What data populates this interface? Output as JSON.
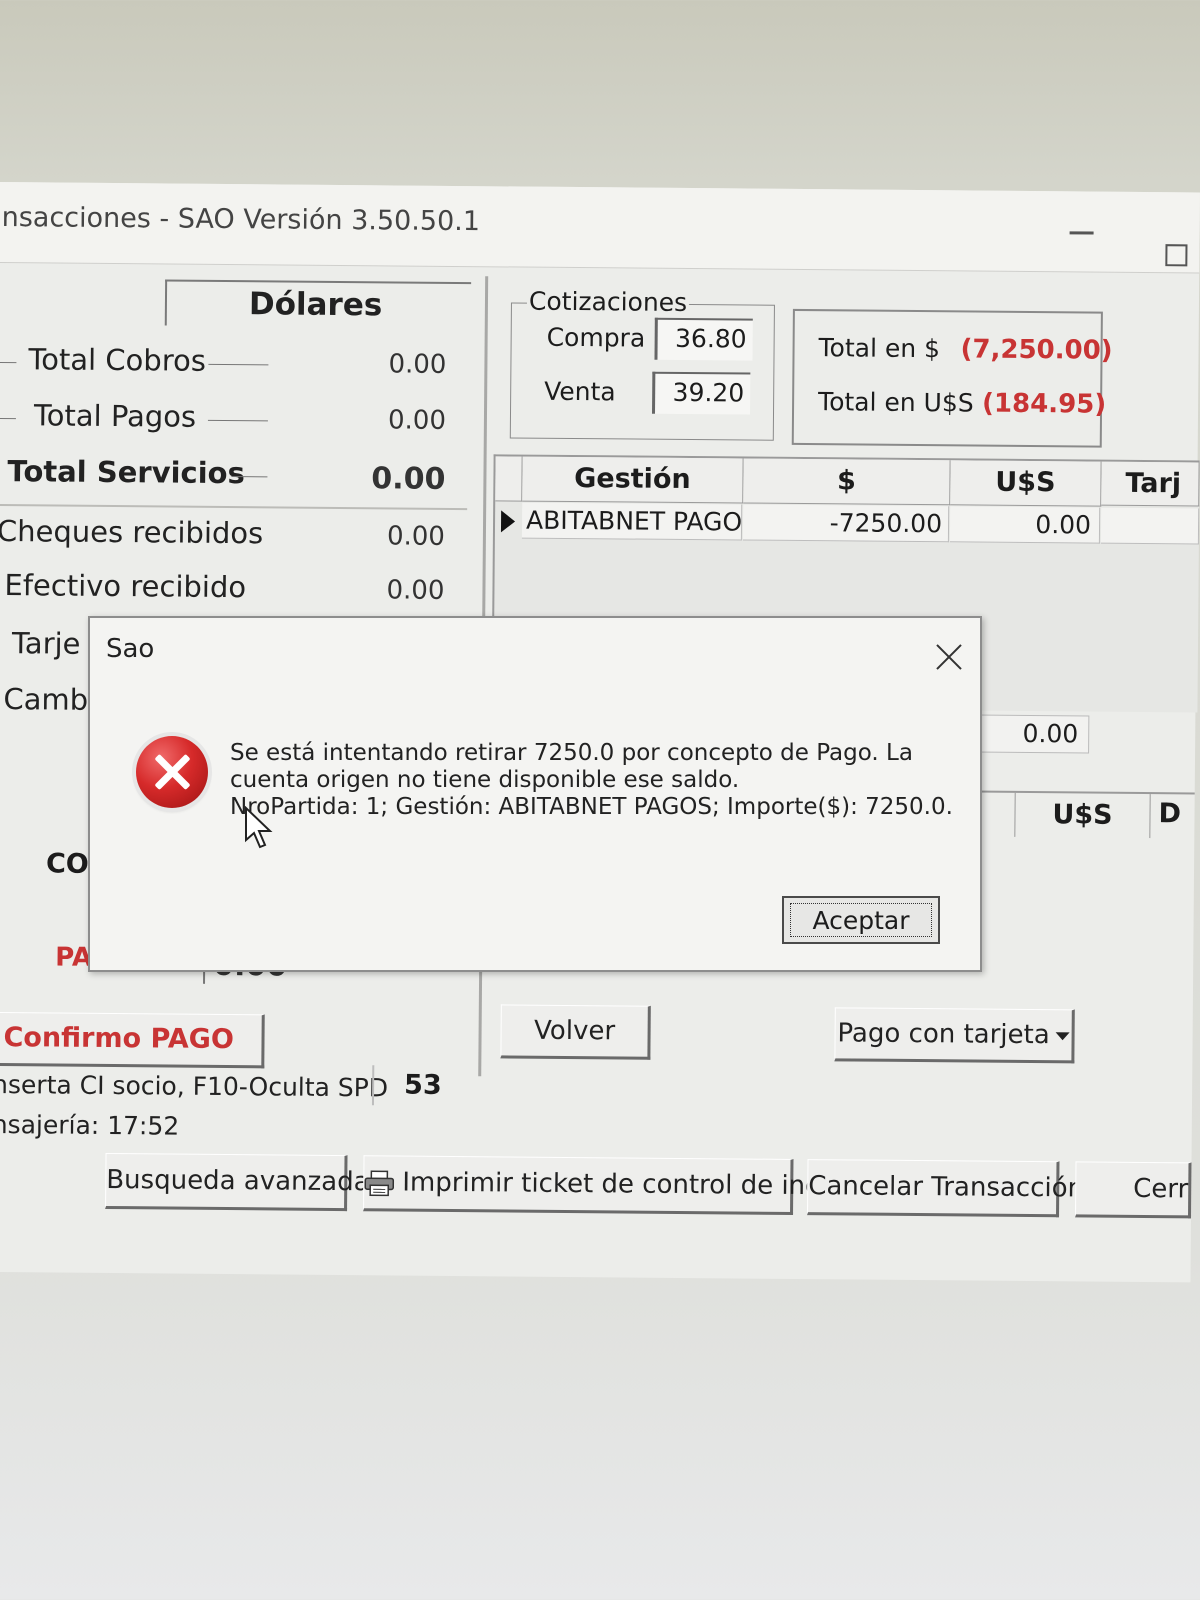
{
  "window": {
    "title": "nsacciones -  SAO Versión 3.50.50.1"
  },
  "summary": {
    "tab_label": "Dólares",
    "rows": [
      {
        "label": "Total Cobros",
        "value": "0.00"
      },
      {
        "label": "Total Pagos",
        "value": "0.00"
      },
      {
        "label": "Total Servicios",
        "value": "0.00"
      },
      {
        "label": "Cheques recibidos",
        "value": "0.00"
      },
      {
        "label": "Efectivo recibido",
        "value": "0.00"
      },
      {
        "label": "Tarje",
        "value": ""
      },
      {
        "label": "Camb",
        "value": ""
      }
    ],
    "co_label": "CO",
    "pa_label": "PA",
    "amount_peek": "0.00"
  },
  "cotizaciones": {
    "legend": "Cotizaciones",
    "compra_label": "Compra",
    "compra_value": "36.80",
    "venta_label": "Venta",
    "venta_value": "39.20"
  },
  "totals": {
    "pesos_label": "Total en $",
    "pesos_value": "(7,250.00)",
    "usd_label": "Total en U$S",
    "usd_value": "(184.95)"
  },
  "grid": {
    "headers": [
      "Gestión",
      "$",
      "U$S",
      "Tarj"
    ],
    "rows": [
      {
        "gestion": "ABITABNET PAGOS",
        "pesos": "-7250.00",
        "usd": "0.00"
      }
    ]
  },
  "right_panel": {
    "value": "0.00",
    "grid2_header": "U$S",
    "grid2_extra": "D"
  },
  "buttons": {
    "confirmo": "Confirmo PAGO",
    "volver": "Volver",
    "pago_tarjeta": "Pago con tarjeta",
    "busqueda": "Busqueda avanzada",
    "imprimir": "Imprimir ticket de control de ingreso",
    "cancelar": "Cancelar Transacción",
    "cerrar": "Cerr"
  },
  "status": {
    "line1": "nserta CI socio, F10-Oculta SPD",
    "count": "53",
    "line2": "nsajería: 17:52"
  },
  "dialog": {
    "title": "Sao",
    "message_lines": [
      "Se está intentando retirar 7250.0 por concepto de Pago. La",
      "cuenta origen no tiene disponible ese saldo.",
      "NroPartida: 1; Gestión: ABITABNET PAGOS; Importe($): 7250.0."
    ],
    "ok_label": "Aceptar",
    "icon": "error-icon"
  },
  "colors": {
    "negative": "#c83434",
    "accent_red": "#c83434"
  }
}
